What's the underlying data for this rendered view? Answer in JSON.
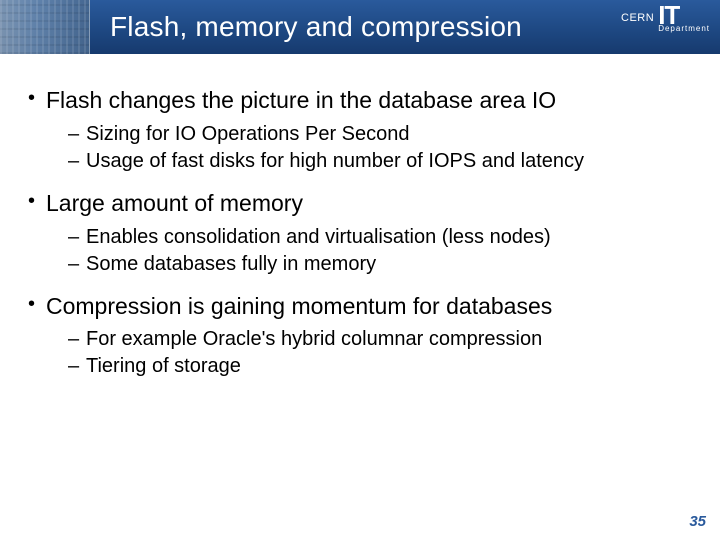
{
  "header": {
    "title": "Flash, memory and compression",
    "logo_org": "CERN",
    "logo_unit": "IT",
    "logo_dept": "Department"
  },
  "bullets": [
    {
      "text": "Flash changes the picture in the database area IO",
      "sub": [
        "Sizing for IO Operations Per Second",
        "Usage of fast disks for high number of IOPS and latency"
      ]
    },
    {
      "text": "Large amount of memory",
      "sub": [
        "Enables consolidation and virtualisation (less nodes)",
        "Some databases fully in memory"
      ]
    },
    {
      "text": "Compression is gaining momentum for databases",
      "sub": [
        "For example Oracle's hybrid columnar compression",
        "Tiering of storage"
      ]
    }
  ],
  "page_number": "35"
}
